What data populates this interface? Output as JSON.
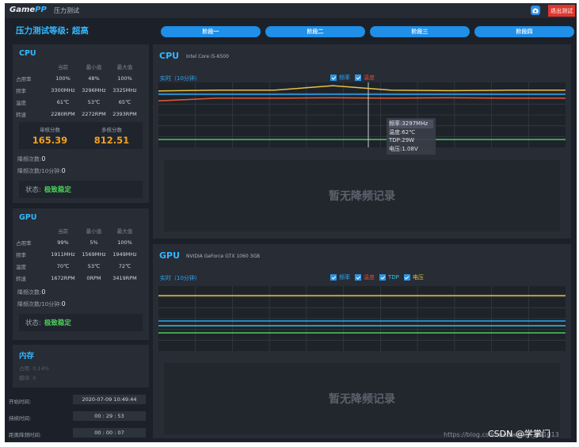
{
  "titlebar": {
    "logo_main": "Game",
    "logo_accent": "PP",
    "title": "压力测试",
    "exit_label": "退出测试"
  },
  "test_level": "压力测试等级: 超高",
  "stages": [
    "阶段一",
    "阶段二",
    "阶段三",
    "阶段四"
  ],
  "cpu_panel": {
    "title": "CPU",
    "headers": [
      "当前",
      "最小值",
      "最大值"
    ],
    "rows": [
      {
        "label": "占用率",
        "values": [
          "100%",
          "48%",
          "100%"
        ]
      },
      {
        "label": "频率",
        "values": [
          "3300MHz",
          "3296MHz",
          "3325MHz"
        ]
      },
      {
        "label": "温度",
        "values": [
          "61℃",
          "53℃",
          "65℃"
        ]
      },
      {
        "label": "转速",
        "values": [
          "2280RPM",
          "2272RPM",
          "2393RPM"
        ]
      }
    ],
    "score_labels": [
      "单核分数",
      "多核分数"
    ],
    "scores": [
      "165.39",
      "812.51"
    ],
    "throttle_label": "降频次数:",
    "throttle_value": "0",
    "throttle10_label": "降频次数/10分钟:",
    "throttle10_value": "0",
    "status_label": "状态:",
    "status_value": "极致稳定"
  },
  "gpu_panel": {
    "title": "GPU",
    "headers": [
      "当前",
      "最小值",
      "最大值"
    ],
    "rows": [
      {
        "label": "占用率",
        "values": [
          "99%",
          "5%",
          "100%"
        ]
      },
      {
        "label": "频率",
        "values": [
          "1911MHz",
          "1569MHz",
          "1949MHz"
        ]
      },
      {
        "label": "温度",
        "values": [
          "70℃",
          "53℃",
          "72℃"
        ]
      },
      {
        "label": "转速",
        "values": [
          "1672RPM",
          "0RPM",
          "3419RPM"
        ]
      }
    ],
    "throttle_label": "降频次数:",
    "throttle_value": "0",
    "throttle10_label": "降频次数/10分钟:",
    "throttle10_value": "0",
    "status_label": "状态:",
    "status_value": "极致稳定"
  },
  "mem_panel": {
    "title": "内存",
    "line1": "占用: 0.14%",
    "line2": "模块: 0"
  },
  "times": [
    {
      "label": "开始时间:",
      "value": "2020-07-09 10:49:44"
    },
    {
      "label": "持续时间:",
      "value": "00 : 29 : 53"
    },
    {
      "label": "距离降频时间:",
      "value": "00 : 00 : 07"
    }
  ],
  "cpu_chart": {
    "title": "CPU",
    "model": "Intel Core i5-6500",
    "realtime_label": "实时（10分钟）",
    "legend": [
      "频率",
      "温度"
    ],
    "tooltip": [
      "频率:3297MHz",
      "温度:62℃",
      "TDP:29W",
      "电压:1.08V"
    ],
    "no_record": "暂无降频记录"
  },
  "gpu_chart": {
    "title": "GPU",
    "model": "NVIDIA GeForce GTX 1060 3GB",
    "realtime_label": "实时（10分钟）",
    "legend": [
      "频率",
      "温度",
      "TDP",
      "电压"
    ],
    "no_record": "暂无降频记录"
  },
  "watermark": "https://blog.csdn.net/weixin_441013",
  "watermark_site": "CSDN @学掌门",
  "colors": {
    "accent": "#33b8ff",
    "stage_button": "#1f8fe8",
    "score": "#f3a023",
    "status_ok": "#49d35a",
    "exit": "#e0362c"
  },
  "chart_data": [
    {
      "type": "line",
      "title": "CPU",
      "series": [
        {
          "name": "频率",
          "values": [
            3296,
            3300,
            3300,
            3325,
            3300,
            3297,
            3300,
            3300
          ]
        },
        {
          "name": "温度",
          "values": [
            55,
            61,
            61,
            62,
            61,
            62,
            61,
            61
          ]
        }
      ]
    },
    {
      "type": "line",
      "title": "GPU",
      "series": [
        {
          "name": "频率",
          "values": [
            1911,
            1911,
            1911,
            1911,
            1911,
            1911,
            1911,
            1911
          ]
        },
        {
          "name": "温度",
          "values": [
            70,
            70,
            70,
            70,
            70,
            70,
            70,
            70
          ]
        },
        {
          "name": "TDP"
        },
        {
          "name": "电压"
        }
      ]
    }
  ]
}
